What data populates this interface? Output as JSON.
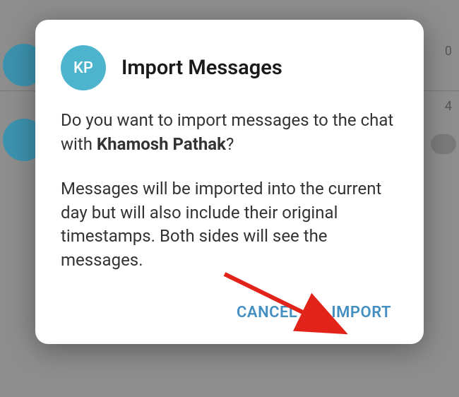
{
  "background": {
    "num1": "0",
    "num2": "4"
  },
  "dialog": {
    "avatar_initials": "KP",
    "title": "Import Messages",
    "para1_prefix": "Do you want to import messages to the chat with ",
    "contact_name": "Khamosh Pathak",
    "para1_suffix": "?",
    "para2": "Messages will be imported into the current day but will also include their original timestamps. Both sides will see the messages.",
    "cancel_label": "CANCEL",
    "import_label": "IMPORT"
  }
}
